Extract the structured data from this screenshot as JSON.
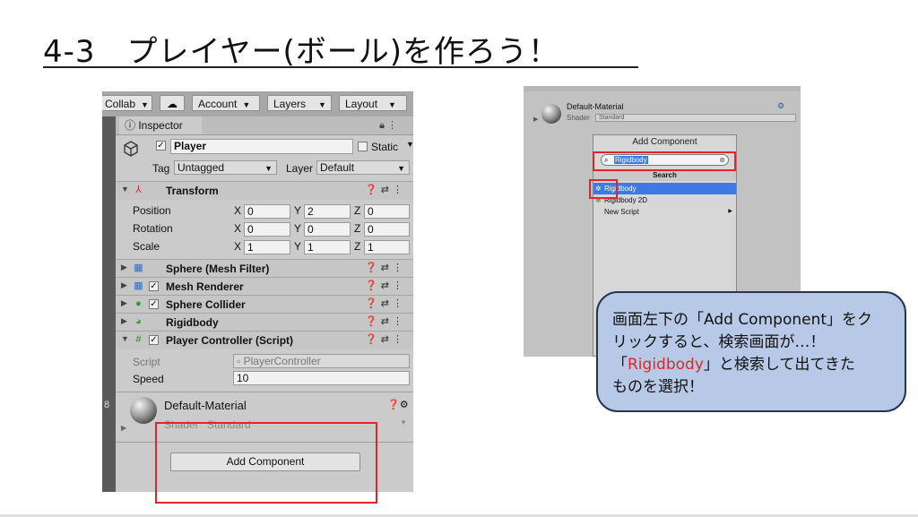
{
  "slide": {
    "title": "4-3　プレイヤー(ボール)を作ろう！"
  },
  "toolbar": {
    "collab": "Collab",
    "account": "Account",
    "layers": "Layers",
    "layout": "Layout"
  },
  "inspector": {
    "tab_label": "Inspector",
    "object_name": "Player",
    "static_label": "Static",
    "tag_label": "Tag",
    "tag_value": "Untagged",
    "layer_label": "Layer",
    "layer_value": "Default",
    "side_number": "8",
    "transform": {
      "title": "Transform",
      "rows": [
        {
          "label": "Position",
          "x": "0",
          "y": "2",
          "z": "0"
        },
        {
          "label": "Rotation",
          "x": "0",
          "y": "0",
          "z": "0"
        },
        {
          "label": "Scale",
          "x": "1",
          "y": "1",
          "z": "1"
        }
      ],
      "axis_x": "X",
      "axis_y": "Y",
      "axis_z": "Z"
    },
    "components": [
      {
        "name": "Sphere (Mesh Filter)",
        "icon": "mesh-filter-icon",
        "checkbox": false
      },
      {
        "name": "Mesh Renderer",
        "icon": "mesh-renderer-icon",
        "checkbox": true
      },
      {
        "name": "Sphere Collider",
        "icon": "sphere-collider-icon",
        "checkbox": true
      },
      {
        "name": "Rigidbody",
        "icon": "rigidbody-icon",
        "checkbox": false
      },
      {
        "name": "Player Controller (Script)",
        "icon": "script-icon",
        "checkbox": true
      }
    ],
    "script_label": "Script",
    "script_value": "PlayerController",
    "speed_label": "Speed",
    "speed_value": "10",
    "material_name": "Default-Material",
    "shader_label": "Shader",
    "shader_value": "Standard",
    "add_component": "Add Component"
  },
  "popup": {
    "material_name": "Default-Material",
    "shader_label": "Shader",
    "shader_value": "Standard",
    "menu_title": "Add Component",
    "search_text": "Rigidbody",
    "search_header": "Search",
    "results": [
      "Rigidbody",
      "Rigidbody 2D",
      "New Script"
    ]
  },
  "callout": {
    "line1": "画面左下の「Add Component」をク",
    "line2": "リックすると、検索画面が…！",
    "line3_pre": "「",
    "line3_red": "Rigidbody",
    "line3_post": "」と検索して出てきた",
    "line4": "ものを選択！"
  },
  "colors": {
    "highlight_red": "#e0262a",
    "callout_fill": "#b7c9e6",
    "callout_border": "#27364f",
    "selection_blue": "#3d7ae3"
  }
}
